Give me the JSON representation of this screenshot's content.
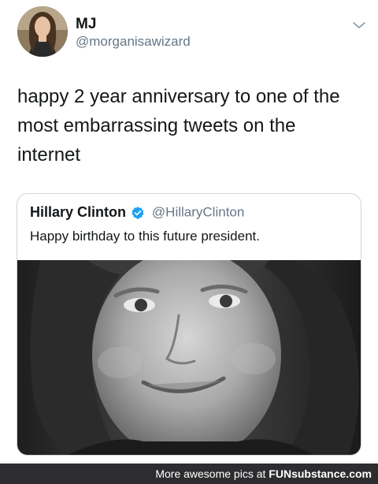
{
  "tweet": {
    "author": {
      "display_name": "MJ",
      "handle": "@morganisawizard"
    },
    "text": "happy 2 year anniversary to one of the most embarrassing tweets on the internet"
  },
  "quoted_tweet": {
    "author": {
      "display_name": "Hillary Clinton",
      "handle": "@HillaryClinton"
    },
    "text": "Happy birthday to this future president."
  },
  "icons": {
    "menu": "chevron-down-icon",
    "verified": "verified-badge-icon",
    "verified_color": "#1da1f2"
  },
  "footer": {
    "text": "More awesome pics at",
    "brand": "FUNsubstance.com",
    "brand_part1": "FUN",
    "brand_part2": "substance.com"
  }
}
